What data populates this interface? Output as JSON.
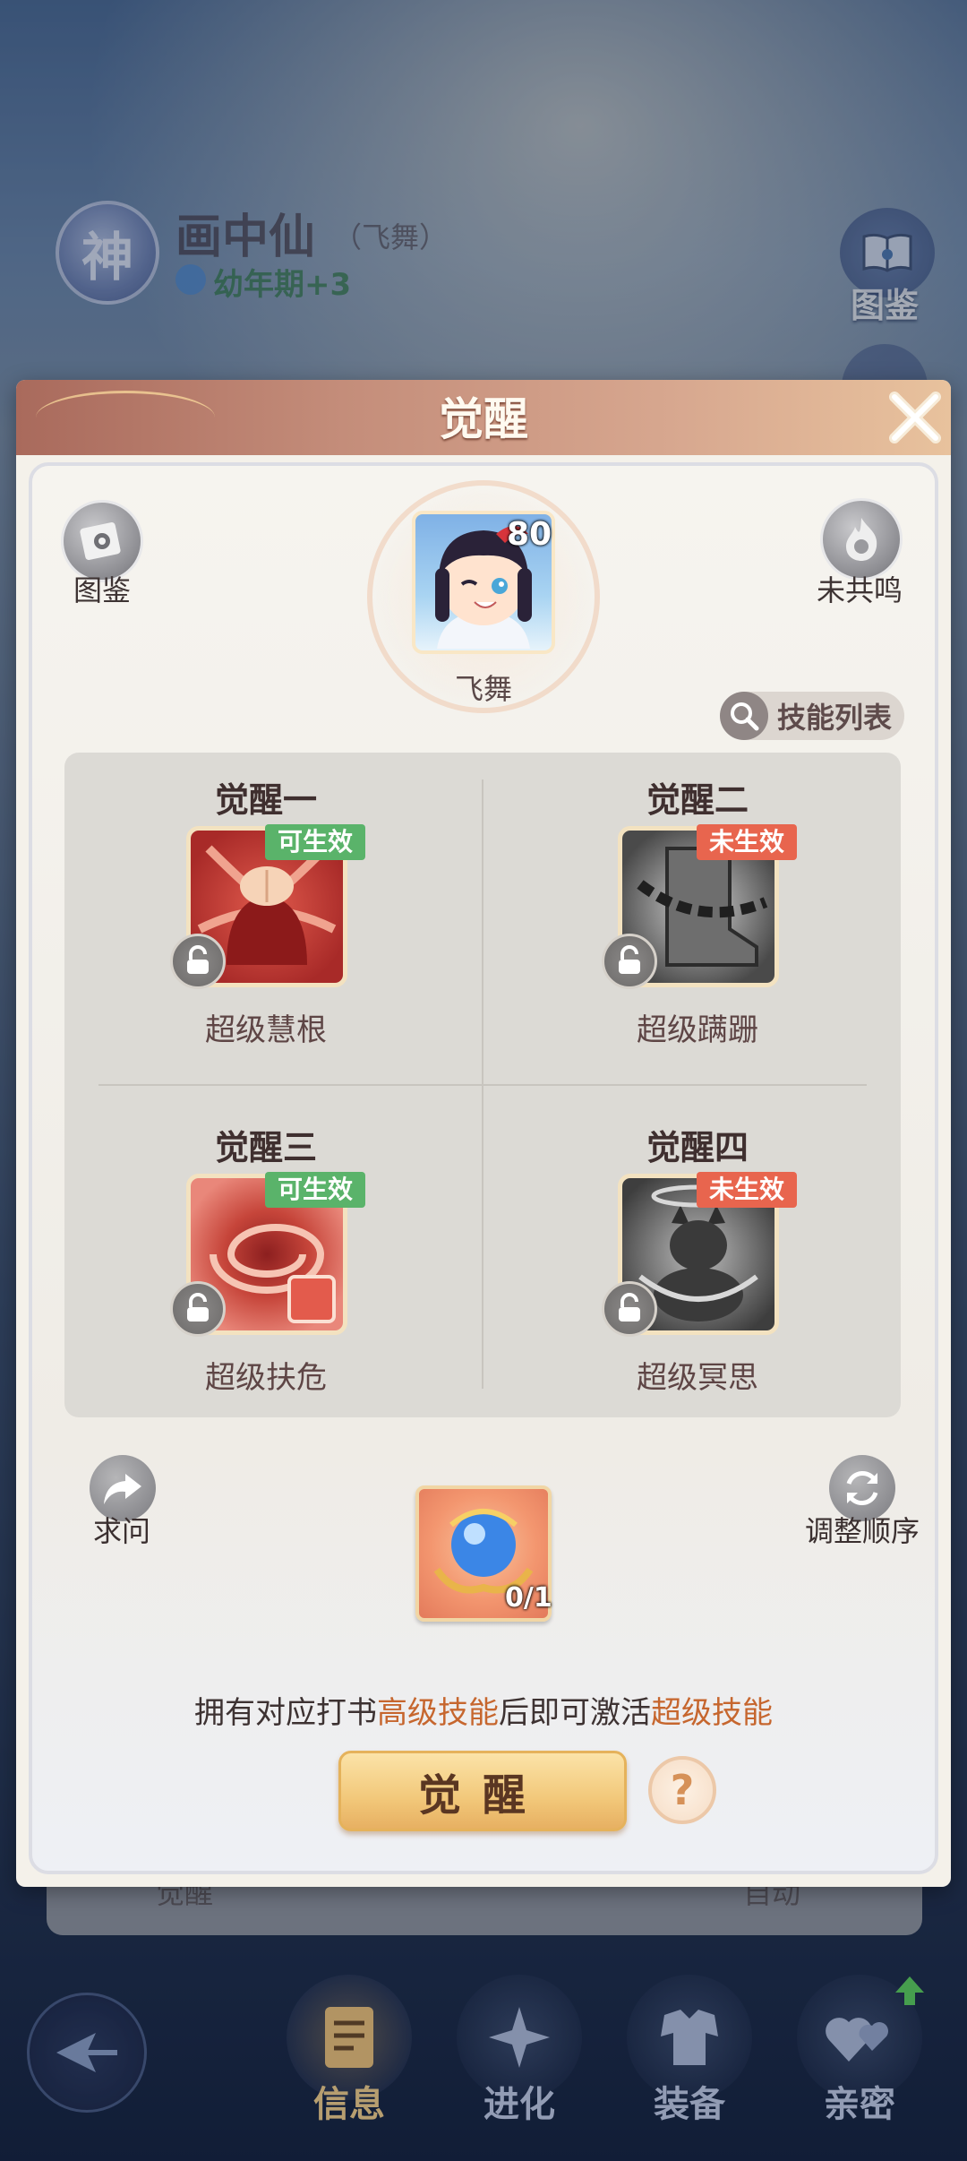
{
  "background": {
    "god_badge": "神",
    "pet_name": "画中仙",
    "pet_subname": "（飞舞）",
    "stage": "幼年期+3",
    "dex_label": "图鉴",
    "under_left": "觉醒",
    "under_right": "自动"
  },
  "bottom_nav": {
    "items": [
      {
        "label": "信息",
        "icon": "document-icon",
        "active": true
      },
      {
        "label": "进化",
        "icon": "sparkle-evolve-icon",
        "active": false
      },
      {
        "label": "装备",
        "icon": "armor-icon",
        "active": false
      },
      {
        "label": "亲密",
        "icon": "hearts-icon",
        "active": false
      }
    ]
  },
  "dialog": {
    "title": "觉醒",
    "dex_label": "图鉴",
    "resonance_label": "未共鸣",
    "pet": {
      "name": "飞舞",
      "level": "80"
    },
    "skill_list_label": "技能列表",
    "slots": [
      {
        "title": "觉醒一",
        "status": "可生效",
        "status_type": "ok",
        "name": "超级慧根",
        "icon": "brain-creature-icon",
        "color": "#b8352f"
      },
      {
        "title": "觉醒二",
        "status": "未生效",
        "status_type": "no",
        "name": "超级蹒跚",
        "icon": "chained-boot-icon",
        "color": "#5b5b5b"
      },
      {
        "title": "觉醒三",
        "status": "可生效",
        "status_type": "ok",
        "name": "超级扶危",
        "icon": "swirl-vortex-icon",
        "color": "#c6453a"
      },
      {
        "title": "觉醒四",
        "status": "未生效",
        "status_type": "no",
        "name": "超级冥思",
        "icon": "meditating-demon-icon",
        "color": "#5b5b5b"
      }
    ],
    "ask_label": "求问",
    "reorder_label": "调整顺序",
    "item_count": "0/1",
    "hint_prefix": "拥有对应打书",
    "hint_highlight1": "高级技能",
    "hint_middle": "后即可激活",
    "hint_highlight2": "超级技能",
    "awaken_button": "觉醒",
    "help_button": "?"
  }
}
